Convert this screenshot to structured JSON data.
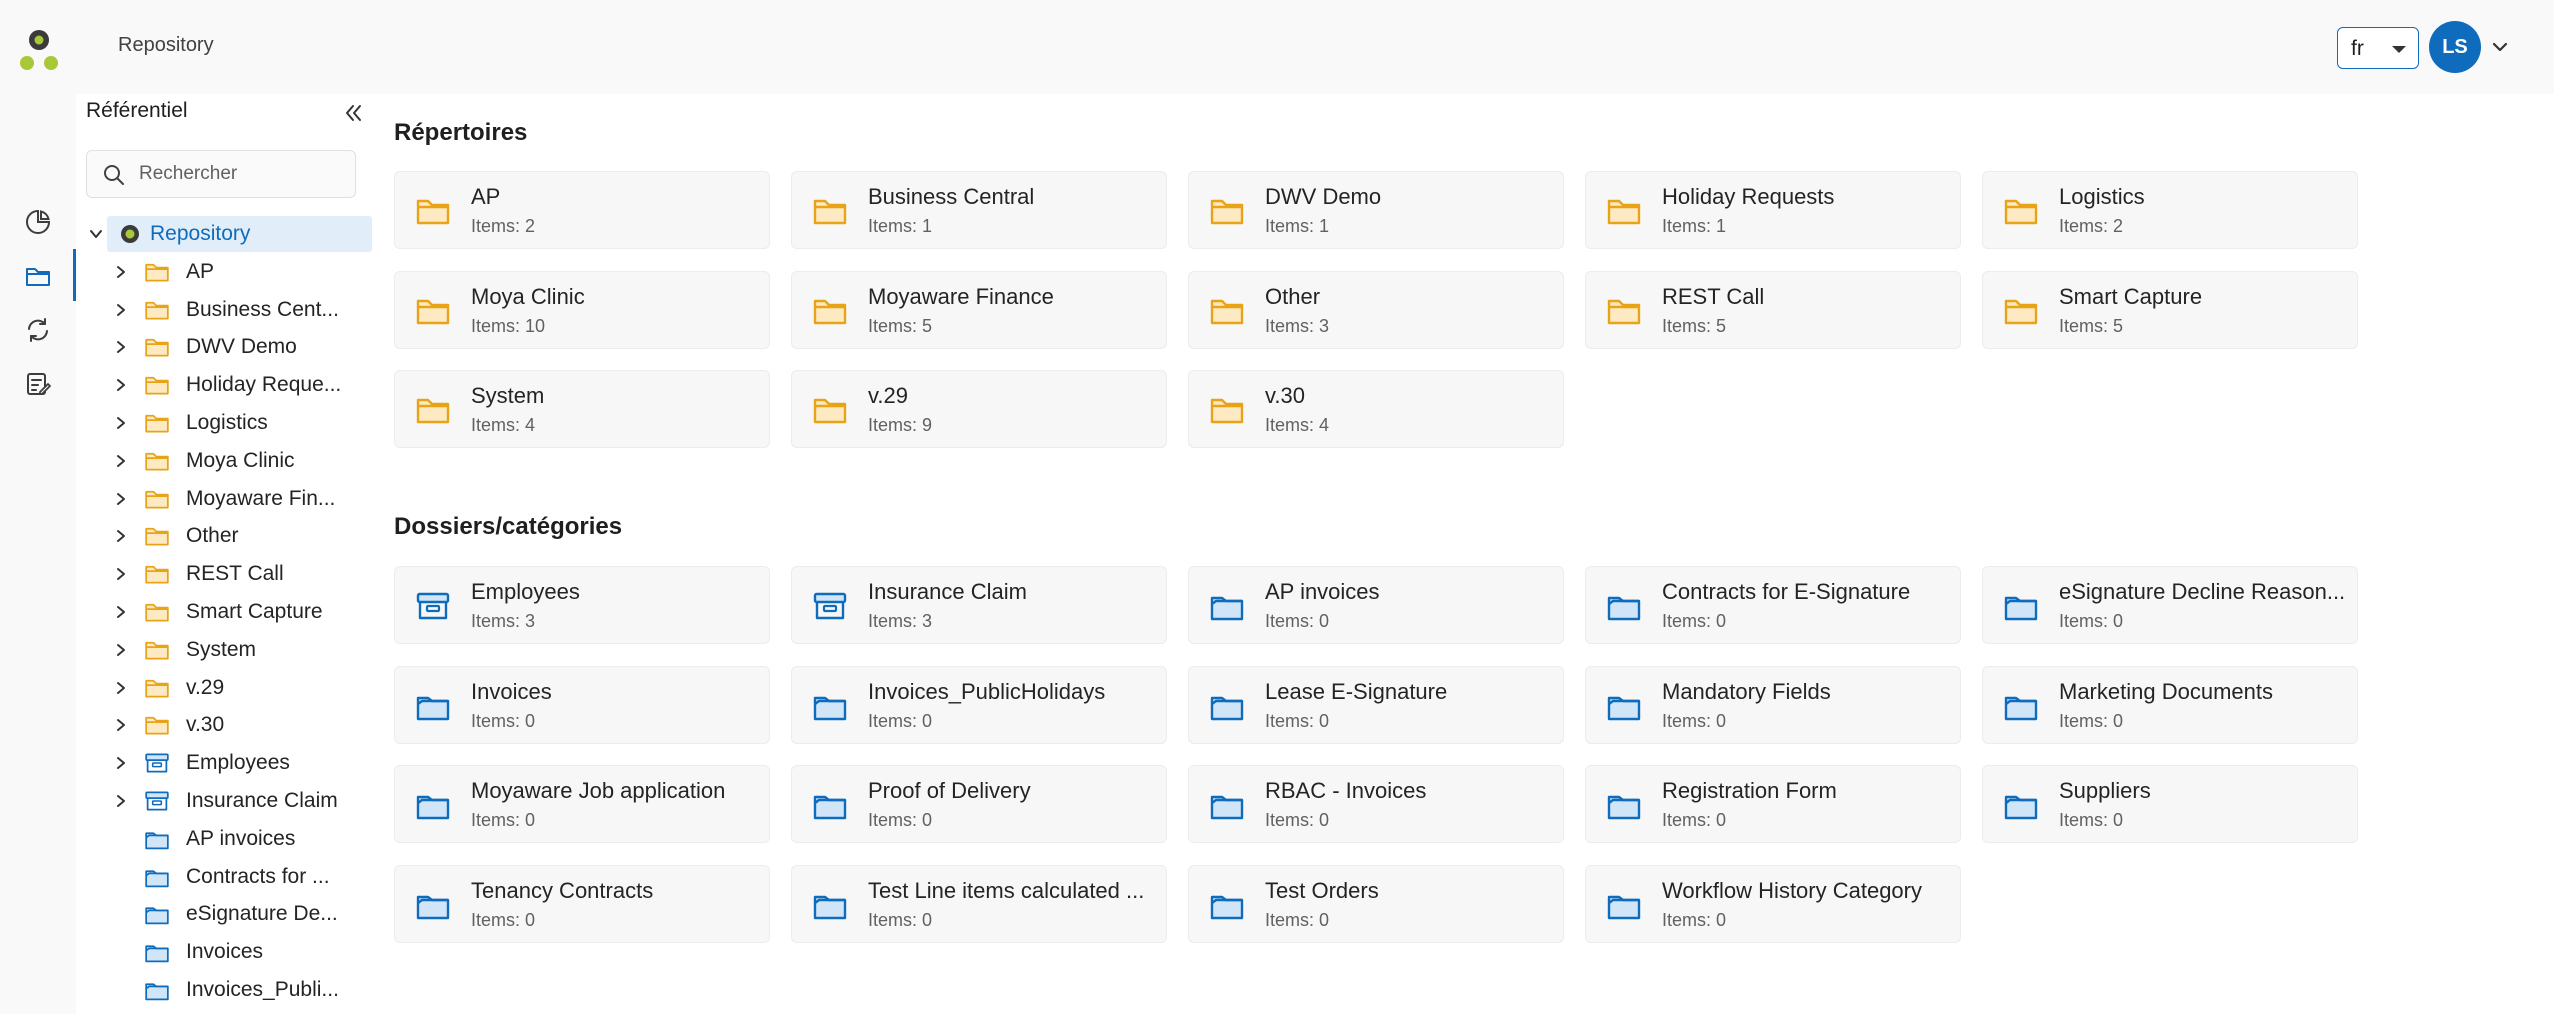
{
  "header": {
    "breadcrumb": "Repository",
    "language": "fr",
    "user_initials": "LS"
  },
  "colors": {
    "accent": "#0f6cbd",
    "folder_yellow": "#e8a317",
    "folder_yellow_fill": "#fde9c2",
    "folder_blue": "#0f6cbd",
    "folder_blue_fill": "#d0e6f8",
    "logo_dark": "#3b3b3b",
    "logo_green": "#a8c83a"
  },
  "rail": {
    "icons": [
      "dashboard-icon",
      "folder-icon",
      "sync-icon",
      "tasks-icon"
    ],
    "active": 1
  },
  "sidebar": {
    "title": "Référentiel",
    "search_placeholder": "Rechercher",
    "root_label": "Repository",
    "items": [
      {
        "label": "AP",
        "kind": "repo",
        "expandable": true
      },
      {
        "label": "Business Cent...",
        "kind": "repo",
        "expandable": true
      },
      {
        "label": "DWV Demo",
        "kind": "repo",
        "expandable": true
      },
      {
        "label": "Holiday Reque...",
        "kind": "repo",
        "expandable": true
      },
      {
        "label": "Logistics",
        "kind": "repo",
        "expandable": true
      },
      {
        "label": "Moya Clinic",
        "kind": "repo",
        "expandable": true
      },
      {
        "label": "Moyaware Fin...",
        "kind": "repo",
        "expandable": true
      },
      {
        "label": "Other",
        "kind": "repo",
        "expandable": true
      },
      {
        "label": "REST Call",
        "kind": "repo",
        "expandable": true
      },
      {
        "label": "Smart Capture",
        "kind": "repo",
        "expandable": true
      },
      {
        "label": "System",
        "kind": "repo",
        "expandable": true
      },
      {
        "label": "v.29",
        "kind": "repo",
        "expandable": true
      },
      {
        "label": "v.30",
        "kind": "repo",
        "expandable": true
      },
      {
        "label": "Employees",
        "kind": "archive",
        "expandable": true
      },
      {
        "label": "Insurance Claim",
        "kind": "archive",
        "expandable": true
      },
      {
        "label": "AP invoices",
        "kind": "category",
        "expandable": false
      },
      {
        "label": "Contracts for ...",
        "kind": "category",
        "expandable": false
      },
      {
        "label": "eSignature De...",
        "kind": "category",
        "expandable": false
      },
      {
        "label": "Invoices",
        "kind": "category",
        "expandable": false
      },
      {
        "label": "Invoices_Publi...",
        "kind": "category",
        "expandable": false
      }
    ]
  },
  "repositories": {
    "title": "Répertoires",
    "items": [
      {
        "name": "AP",
        "count": "Items: 2"
      },
      {
        "name": "Business Central",
        "count": "Items: 1"
      },
      {
        "name": "DWV Demo",
        "count": "Items: 1"
      },
      {
        "name": "Holiday Requests",
        "count": "Items: 1"
      },
      {
        "name": "Logistics",
        "count": "Items: 2"
      },
      {
        "name": "Moya Clinic",
        "count": "Items: 10"
      },
      {
        "name": "Moyaware Finance",
        "count": "Items: 5"
      },
      {
        "name": "Other",
        "count": "Items: 3"
      },
      {
        "name": "REST Call",
        "count": "Items: 5"
      },
      {
        "name": "Smart Capture",
        "count": "Items: 5"
      },
      {
        "name": "System",
        "count": "Items: 4"
      },
      {
        "name": "v.29",
        "count": "Items: 9"
      },
      {
        "name": "v.30",
        "count": "Items: 4"
      }
    ]
  },
  "categories": {
    "title": "Dossiers/catégories",
    "items": [
      {
        "name": "Employees",
        "count": "Items: 3",
        "kind": "archive"
      },
      {
        "name": "Insurance Claim",
        "count": "Items: 3",
        "kind": "archive"
      },
      {
        "name": "AP invoices",
        "count": "Items: 0",
        "kind": "category"
      },
      {
        "name": "Contracts for E-Signature",
        "count": "Items: 0",
        "kind": "category"
      },
      {
        "name": "eSignature Decline Reason...",
        "count": "Items: 0",
        "kind": "category"
      },
      {
        "name": "Invoices",
        "count": "Items: 0",
        "kind": "category"
      },
      {
        "name": "Invoices_PublicHolidays",
        "count": "Items: 0",
        "kind": "category"
      },
      {
        "name": "Lease E-Signature",
        "count": "Items: 0",
        "kind": "category"
      },
      {
        "name": "Mandatory Fields",
        "count": "Items: 0",
        "kind": "category"
      },
      {
        "name": "Marketing Documents",
        "count": "Items: 0",
        "kind": "category"
      },
      {
        "name": "Moyaware Job application",
        "count": "Items: 0",
        "kind": "category"
      },
      {
        "name": "Proof of Delivery",
        "count": "Items: 0",
        "kind": "category"
      },
      {
        "name": "RBAC - Invoices",
        "count": "Items: 0",
        "kind": "category"
      },
      {
        "name": "Registration Form",
        "count": "Items: 0",
        "kind": "category"
      },
      {
        "name": "Suppliers",
        "count": "Items: 0",
        "kind": "category"
      },
      {
        "name": "Tenancy Contracts",
        "count": "Items: 0",
        "kind": "category"
      },
      {
        "name": "Test Line items calculated ...",
        "count": "Items: 0",
        "kind": "category"
      },
      {
        "name": "Test Orders",
        "count": "Items: 0",
        "kind": "category"
      },
      {
        "name": "Workflow History Category",
        "count": "Items: 0",
        "kind": "category"
      }
    ]
  }
}
